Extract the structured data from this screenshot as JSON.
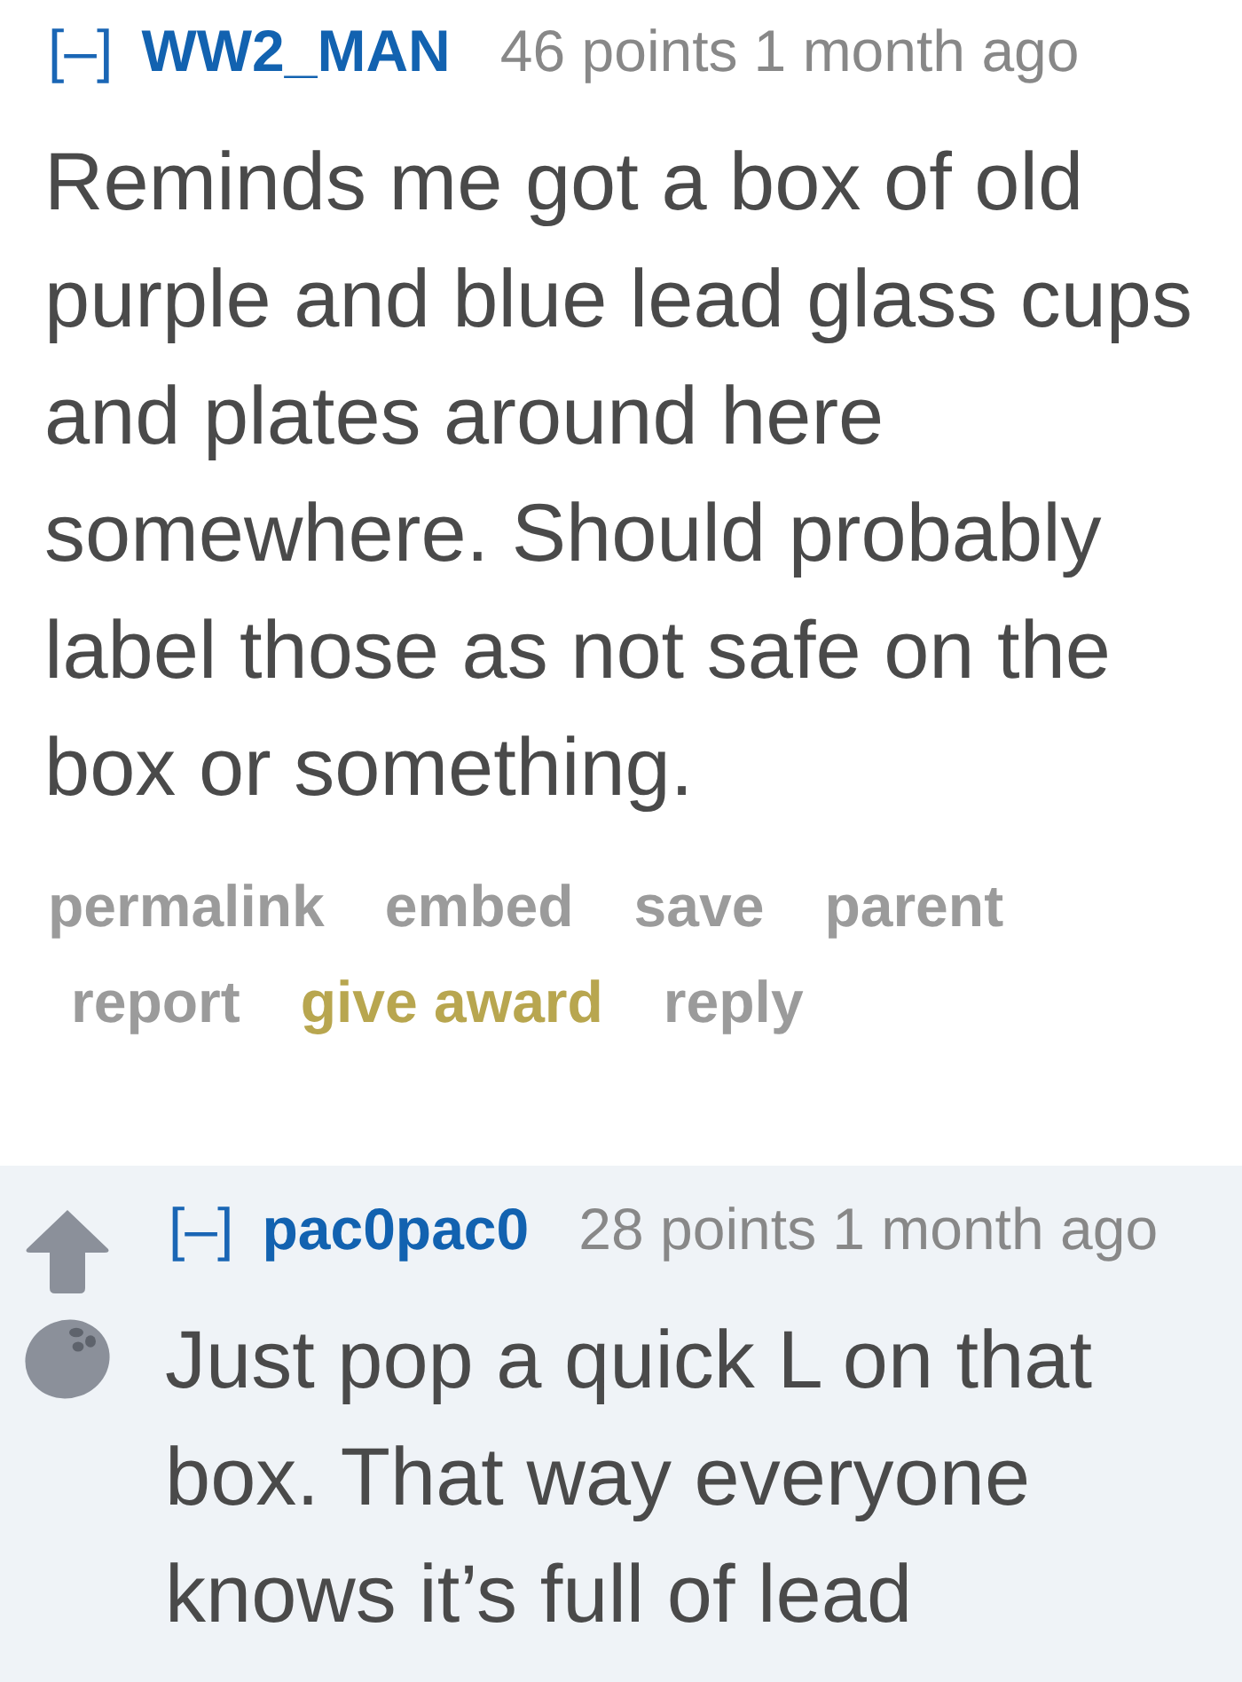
{
  "comments": [
    {
      "collapse_toggle": "[–]",
      "author": "WW2_MAN",
      "score": "46 points",
      "time": "1 month ago",
      "votes_shown": false,
      "body": "Reminds me got a box of old purple and blue lead glass cups and plates around here somewhere. Should probably label those as not safe on the box or something.",
      "actions": [
        {
          "label": "permalink",
          "kind": "link"
        },
        {
          "label": "embed",
          "kind": "link"
        },
        {
          "label": "save",
          "kind": "link"
        },
        {
          "label": "parent",
          "kind": "link"
        },
        {
          "label": "report",
          "kind": "link"
        },
        {
          "label": "give award",
          "kind": "award"
        },
        {
          "label": "reply",
          "kind": "link"
        }
      ],
      "children": [
        {
          "collapse_toggle": "[–]",
          "author": "pac0pac0",
          "score": "28 points",
          "time": "1 month ago",
          "votes_shown": true,
          "body": "Just pop a quick L on that box. That way everyone knows it’s full of lead"
        }
      ]
    }
  ]
}
